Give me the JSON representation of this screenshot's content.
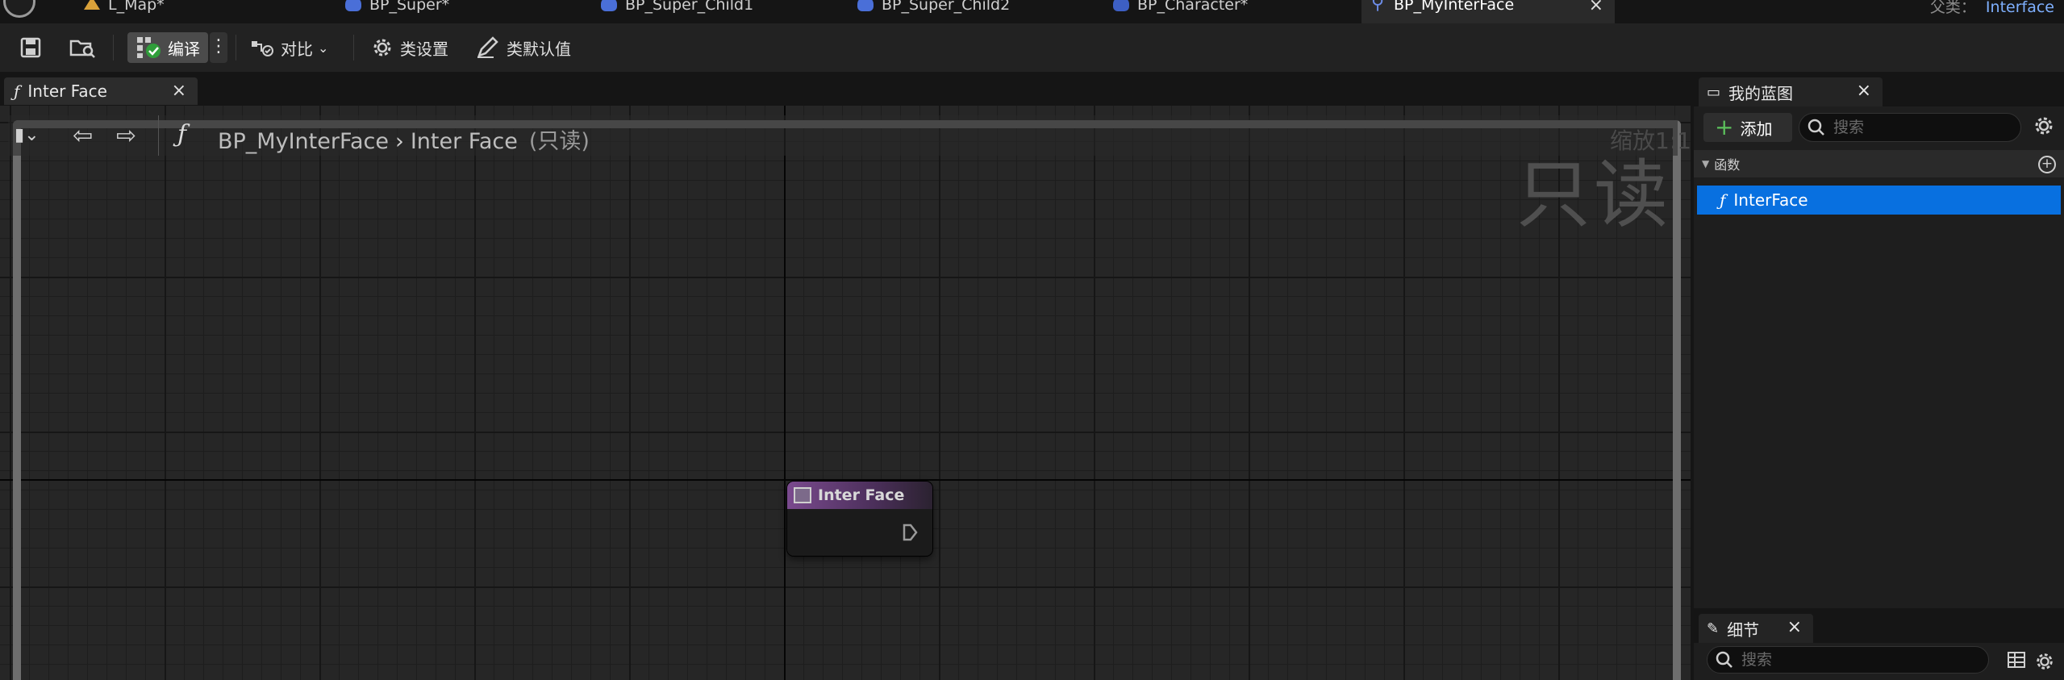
{
  "doc_tabs": [
    {
      "label": "L_Map*",
      "icon": "map-icon"
    },
    {
      "label": "BP_Super*",
      "icon": "blueprint-icon"
    },
    {
      "label": "BP_Super_Child1",
      "icon": "blueprint-icon"
    },
    {
      "label": "BP_Super_Child2",
      "icon": "blueprint-icon"
    },
    {
      "label": "BP_Character*",
      "icon": "character-blueprint-icon"
    },
    {
      "label": "BP_MyInterFace",
      "icon": "interface-icon",
      "active": true,
      "close": "×"
    }
  ],
  "parent_class": {
    "label": "父类：",
    "value": "Interface"
  },
  "toolbar": {
    "compile_label": "编译",
    "more_glyph": "⋮",
    "diff_label": "对比",
    "class_settings_label": "类设置",
    "class_defaults_label": "类默认值"
  },
  "graph_tab": {
    "fx": "ƒ",
    "label": "Inter Face",
    "close": "×"
  },
  "graph": {
    "breadcrumb_fx": "ƒ",
    "breadcrumb_root": "BP_MyInterFace",
    "breadcrumb_chevron": "›",
    "breadcrumb_leaf": "Inter Face",
    "breadcrumb_readonly": "(只读)",
    "zoom_label": "缩放1:1",
    "readonly_watermark": "只读",
    "node_title": "Inter Face"
  },
  "my_blueprint": {
    "tab_label": "我的蓝图",
    "close": "×",
    "add_label": "添加",
    "search_placeholder": "搜索",
    "functions_header": "函数",
    "functions": [
      {
        "fx": "ƒ",
        "name": "InterFace"
      }
    ]
  },
  "details": {
    "tab_label": "细节",
    "close": "×",
    "search_placeholder": "搜索"
  },
  "colors": {
    "selection": "#0870e0",
    "node_header": "#7a4a8e",
    "parent_class_value": "#7fb0ff",
    "add_plus": "#5cc05c"
  }
}
